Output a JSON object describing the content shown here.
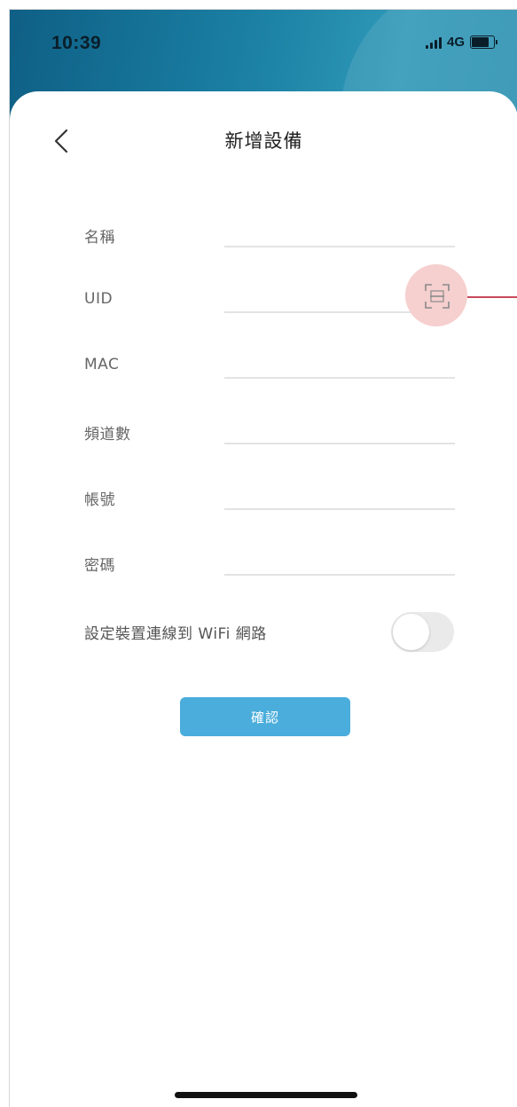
{
  "status_bar": {
    "time": "10:39",
    "network": "4G",
    "icons": [
      "signal-icon",
      "battery-icon"
    ]
  },
  "nav": {
    "back_icon": "chevron-left-icon",
    "title": "新增設備"
  },
  "fields": [
    {
      "label": "名稱",
      "value": ""
    },
    {
      "label": "UID",
      "value": ""
    },
    {
      "label": "MAC",
      "value": ""
    },
    {
      "label": "頻道數",
      "value": ""
    },
    {
      "label": "帳號",
      "value": ""
    },
    {
      "label": "密碼",
      "value": ""
    }
  ],
  "uid_scan": {
    "icon": "qr-scan-icon",
    "highlight_color": "#f6cfcf",
    "callout_color": "#c8485a"
  },
  "wifi_setting": {
    "label": "設定裝置連線到 WiFi 網路",
    "enabled": false
  },
  "confirm_button": {
    "label": "確認"
  },
  "colors": {
    "header_dark": "#0f5f85",
    "header_light": "#2f98b7",
    "primary_button": "#4aaddb",
    "label_text": "#666666",
    "divider": "#e3e3e3"
  }
}
